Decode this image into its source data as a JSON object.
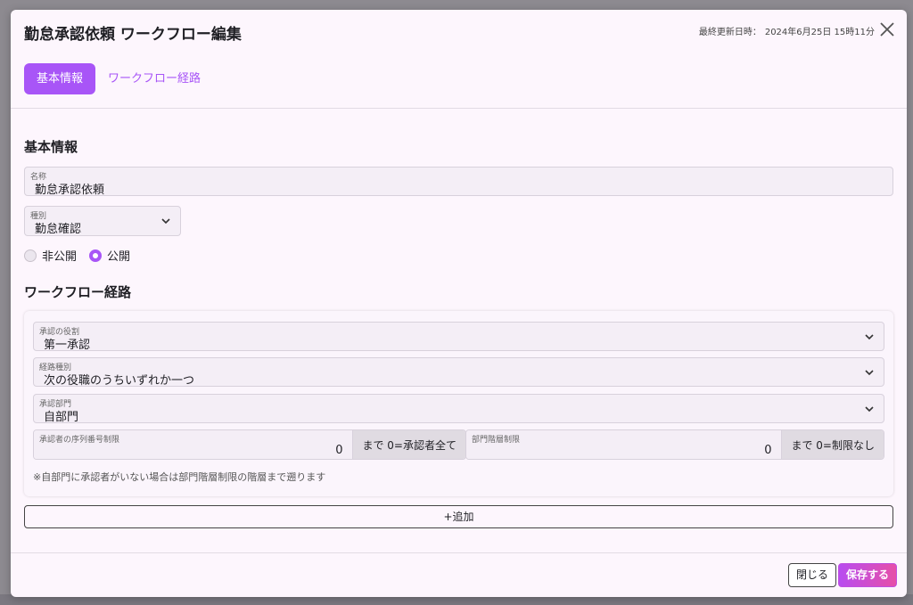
{
  "modal": {
    "title": "勤怠承認依頼 ワークフロー編集",
    "last_updated_label": "最終更新日時：",
    "last_updated_value": "2024年6月25日 15時11分"
  },
  "tabs": [
    {
      "label": "基本情報",
      "active": true
    },
    {
      "label": "ワークフロー経路",
      "active": false
    }
  ],
  "basic": {
    "section_title": "基本情報",
    "name_label": "名称",
    "name_value": "勤怠承認依頼",
    "type_label": "種別",
    "type_value": "勤怠確認",
    "visibility": {
      "private_label": "非公開",
      "public_label": "公開",
      "selected": "public"
    }
  },
  "route": {
    "section_title": "ワークフロー経路",
    "role_label": "承認の役割",
    "role_value": "第一承認",
    "route_type_label": "経路種別",
    "route_type_value": "次の役職のうちいずれか一つ",
    "dept_label": "承認部門",
    "dept_value": "自部門",
    "order_limit_label": "承認者の序列番号制限",
    "order_limit_value": "0",
    "order_limit_suffix": "まで 0=承認者全て",
    "dept_level_label": "部門階層制限",
    "dept_level_value": "0",
    "dept_level_suffix": "まで 0=制限なし",
    "note": "※自部門に承認者がいない場合は部門階層制限の階層まで遡ります"
  },
  "add_button": "+追加",
  "footer": {
    "close_label": "閉じる",
    "save_label": "保存する"
  },
  "colors": {
    "accent": "#a855f7",
    "save_gradient_start": "#b84cf0",
    "save_gradient_end": "#e64fa8"
  }
}
